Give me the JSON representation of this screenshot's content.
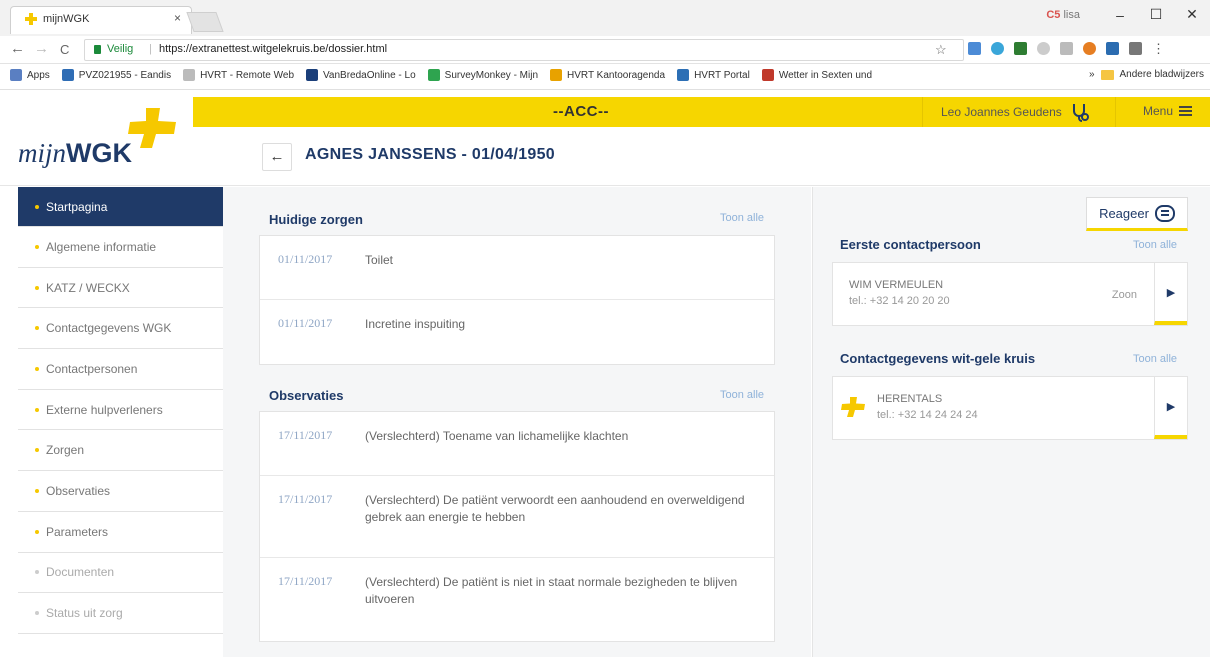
{
  "browser": {
    "tab_title": "mijnWGK",
    "tab_close": "×",
    "profile_label": "lisa",
    "win_min": "–",
    "win_max": "☐",
    "win_close": "✕",
    "nav_back": "←",
    "nav_forward": "→",
    "nav_reload": "C",
    "secure_label": "Veilig",
    "separator": "|",
    "url": "https://extranettest.witgelekruis.be/dossier.html",
    "star": "☆",
    "bookmarks": [
      {
        "label": "Apps",
        "color": "#5a7fc2"
      },
      {
        "label": "PVZ021955 - Eandis",
        "color": "#2f6db5"
      },
      {
        "label": "HVRT - Remote Web",
        "color": "#bbbbbb"
      },
      {
        "label": "VanBredaOnline - Lo",
        "color": "#1b3f7a"
      },
      {
        "label": "SurveyMonkey - Mijn",
        "color": "#2ea44f"
      },
      {
        "label": "HVRT Kantooragenda",
        "color": "#e8a200"
      },
      {
        "label": "HVRT Portal",
        "color": "#2c6fb5"
      },
      {
        "label": "Wetter in Sexten und",
        "color": "#c0392b"
      }
    ],
    "bookmarks_more": "»",
    "other_bookmarks": "Andere bladwijzers"
  },
  "header": {
    "environment": "--ACC--",
    "user_name": "Leo Joannes Geudens",
    "menu_label": "Menu",
    "logo_mijn": "mijn",
    "logo_wgk": "WGK"
  },
  "patient": {
    "back_arrow": "←",
    "title": "AGNES JANSSENS - 01/04/1950"
  },
  "sidebar": {
    "items": [
      {
        "label": "Startpagina"
      },
      {
        "label": "Algemene informatie"
      },
      {
        "label": "KATZ / WECKX"
      },
      {
        "label": "Contactgegevens WGK"
      },
      {
        "label": "Contactpersonen"
      },
      {
        "label": "Externe hulpverleners"
      },
      {
        "label": "Zorgen"
      },
      {
        "label": "Observaties"
      },
      {
        "label": "Parameters"
      },
      {
        "label": "Documenten"
      },
      {
        "label": "Status uit zorg"
      }
    ]
  },
  "zorgen": {
    "title": "Huidige zorgen",
    "show_all": "Toon alle",
    "rows": [
      {
        "date": "01/11/2017",
        "text": "Toilet"
      },
      {
        "date": "01/11/2017",
        "text": "Incretine inspuiting"
      }
    ]
  },
  "observaties": {
    "title": "Observaties",
    "show_all": "Toon alle",
    "rows": [
      {
        "date": "17/11/2017",
        "text": "(Verslechterd) Toename van lichamelijke klachten"
      },
      {
        "date": "17/11/2017",
        "text": "(Verslechterd) De patiënt verwoordt een aanhoudend en overweldigend gebrek aan energie te hebben"
      },
      {
        "date": "17/11/2017",
        "text": "(Verslechterd) De patiënt is niet in staat normale bezigheden te blijven uitvoeren"
      }
    ]
  },
  "right": {
    "reageer": "Reageer",
    "contact_title": "Eerste contactpersoon",
    "contact_show_all": "Toon alle",
    "contact": {
      "name": "WIM VERMEULEN",
      "tel": "tel.: +32 14 20 20 20",
      "relation": "Zoon",
      "arrow": "▶"
    },
    "wgk_title": "Contactgegevens wit-gele kruis",
    "wgk_show_all": "Toon alle",
    "wgk": {
      "name": "HERENTALS",
      "tel": "tel.: +32 14 24 24 24",
      "arrow": "▶"
    }
  },
  "colors": {
    "brand_yellow": "#f6d600",
    "brand_navy": "#1f3a68"
  }
}
